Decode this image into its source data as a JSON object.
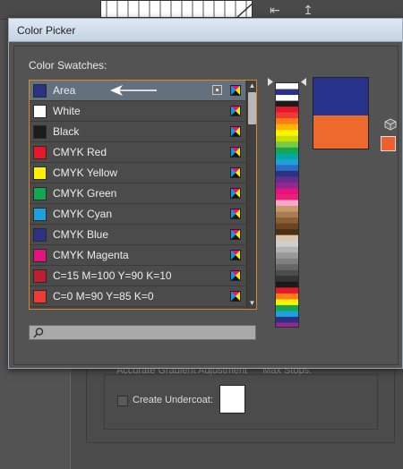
{
  "background_app": {
    "accurate_gradient_label": "Accurate Gradient Adjustment",
    "max_stops_label": "Max Stops:",
    "create_undercoat_label": "Create Undercoat:"
  },
  "dialog": {
    "title": "Color Picker",
    "swatches_label": "Color Swatches:",
    "swatches": [
      {
        "name": "Area",
        "color": "#2b3183",
        "selected": true,
        "spot_icon": "spot-target-icon",
        "mode_icon": "cmyk-icon"
      },
      {
        "name": "White",
        "color": "#ffffff",
        "mode_icon": "cmyk-icon"
      },
      {
        "name": "Black",
        "color": "#1b1b1b",
        "mode_icon": "cmyk-icon"
      },
      {
        "name": "CMYK Red",
        "color": "#e3192b",
        "mode_icon": "cmyk-icon"
      },
      {
        "name": "CMYK Yellow",
        "color": "#fff200",
        "mode_icon": "cmyk-icon"
      },
      {
        "name": "CMYK Green",
        "color": "#14a651",
        "mode_icon": "cmyk-icon"
      },
      {
        "name": "CMYK Cyan",
        "color": "#1ea0dc",
        "mode_icon": "cmyk-icon"
      },
      {
        "name": "CMYK Blue",
        "color": "#2b3183",
        "mode_icon": "cmyk-icon"
      },
      {
        "name": "CMYK Magenta",
        "color": "#e4147e",
        "mode_icon": "cmyk-icon"
      },
      {
        "name": "C=15 M=100 Y=90 K=10",
        "color": "#be1e2d",
        "mode_icon": "cmyk-icon"
      },
      {
        "name": "C=0 M=90 Y=85 K=0",
        "color": "#ee3b33",
        "mode_icon": "cmyk-icon"
      }
    ],
    "search": {
      "placeholder": "",
      "value": ""
    },
    "preview": {
      "new_color": "#27338a",
      "current_color": "#ee6a2c"
    },
    "gamut_swatch": "#ee5f2e",
    "accent_border": "#d8862a"
  }
}
